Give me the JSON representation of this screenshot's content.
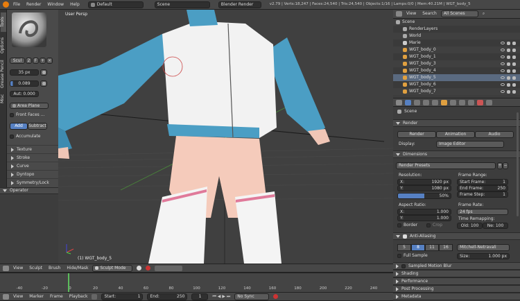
{
  "topbar": {
    "menus": [
      "File",
      "Render",
      "Window",
      "Help"
    ],
    "screen_layout": "Default",
    "scene": "Scene",
    "engine": "Blender Render",
    "stats": "v2.79 | Verts:18,247 | Faces:24,540 | Tris:24,540 | Objects:1/16 | Lamps:0/0 | Mem:40.21M | WGT_body_5"
  },
  "side_tabs": [
    "Tools",
    "Options",
    "Grease Pencil",
    "Misc"
  ],
  "toolshelf": {
    "brush_tab": "Scul",
    "brush_num": "2",
    "fake_user": "F",
    "radius": "35 px",
    "strength": "0.089",
    "autosmooth": "Aut: 0.000",
    "sculpt_plane": "Area Plane",
    "front_faces": "Front Faces ...",
    "add": "Add",
    "subtract": "Subtract",
    "accumulate": "Accumulate",
    "sections": [
      "Texture",
      "Stroke",
      "Curve",
      "Dyntopo",
      "Symmetry/Lock"
    ],
    "operator": "Operator"
  },
  "viewport": {
    "view_name": "User Persp",
    "object_label": "(1) WGT_body_5"
  },
  "view3d_header": {
    "menus": [
      "View",
      "Sculpt",
      "Brush",
      "Hide/Mask"
    ],
    "mode": "Sculpt Mode"
  },
  "timeline": {
    "ruler": [
      "-40",
      "-20",
      "0",
      "20",
      "40",
      "60",
      "80",
      "100",
      "120",
      "140",
      "160",
      "180",
      "200",
      "220",
      "240",
      "260"
    ],
    "menus": [
      "View",
      "Marker",
      "Frame",
      "Playback"
    ],
    "start_label": "Start:",
    "start_value": "1",
    "end_label": "End:",
    "end_value": "250",
    "current_frame": "1",
    "sync": "No Sync"
  },
  "outliner": {
    "menus": [
      "View",
      "Search"
    ],
    "filter": "All Scenes",
    "items": [
      {
        "label": "Scene",
        "indent": 0
      },
      {
        "label": "RenderLayers",
        "indent": 1
      },
      {
        "label": "World",
        "indent": 1
      },
      {
        "label": "Marie",
        "indent": 1
      },
      {
        "label": "WGT_body_0",
        "indent": 1
      },
      {
        "label": "WGT_body_1",
        "indent": 1
      },
      {
        "label": "WGT_body_3",
        "indent": 1
      },
      {
        "label": "WGT_body_4",
        "indent": 1
      },
      {
        "label": "WGT_body_5",
        "indent": 1
      },
      {
        "label": "WGT_body_6",
        "indent": 1
      },
      {
        "label": "WGT_body_7",
        "indent": 1
      }
    ]
  },
  "properties": {
    "scene": "Scene",
    "render_title": "Render",
    "render_btn": "Render",
    "animation_btn": "Animation",
    "audio_btn": "Audio",
    "display_label": "Display:",
    "display_value": "Image Editor",
    "dimensions_title": "Dimensions",
    "render_presets": "Render Presets",
    "resolution_label": "Resolution:",
    "res_x": "1920 px",
    "res_y": "1080 px",
    "res_pct": "50%",
    "frame_range_label": "Frame Range:",
    "start_frame": "1",
    "end_frame": "250",
    "frame_step": "1",
    "aspect_label": "Aspect Ratio:",
    "aspect_x": "1.000",
    "aspect_y": "1.000",
    "frame_rate_label": "Frame Rate:",
    "frame_rate": "24 fps",
    "time_remap_label": "Time Remapping:",
    "old": "Old: 100",
    "new": "Ne: 100",
    "border": "Border",
    "crop": "Crop",
    "aa_title": "Anti-Aliasing",
    "aa_samples": [
      "5",
      "8",
      "11",
      "16"
    ],
    "aa_filter": "Mitchell-Netravali",
    "full_sample": "Full Sample",
    "size": "1.000 px",
    "sections": [
      "Sampled Motion Blur",
      "Shading",
      "Performance",
      "Post Processing",
      "Metadata"
    ]
  }
}
